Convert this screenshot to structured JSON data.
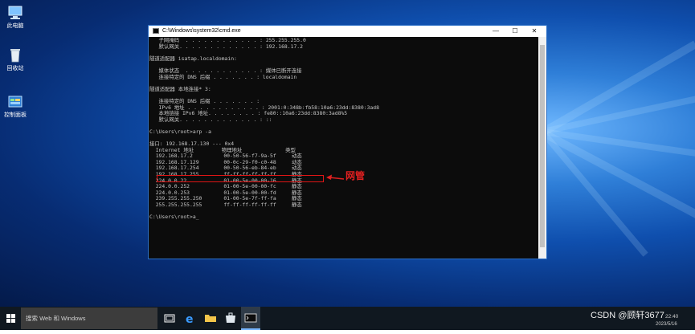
{
  "desktop": {
    "icons": [
      {
        "name": "此电脑"
      },
      {
        "name": "回收站"
      },
      {
        "name": "控制面板"
      }
    ]
  },
  "window": {
    "title": "C:\\Windows\\system32\\cmd.exe",
    "buttons": {
      "minimize": "—",
      "maximize": "☐",
      "close": "✕"
    }
  },
  "console": {
    "lines": [
      "   子网掩码  . . . . . . . . . . . . : 255.255.255.0",
      "   默认网关. . . . . . . . . . . . . : 192.168.17.2",
      "",
      "隧道适配器 isatap.localdomain:",
      "",
      "   媒体状态  . . . . . . . . . . . . : 媒体已断开连接",
      "   连接特定的 DNS 后缀 . . . . . . . : localdomain",
      "",
      "隧道适配器 本地连接* 3:",
      "",
      "   连接特定的 DNS 后缀 . . . . . . . :",
      "   IPv6 地址 . . . . . . . . . . . . : 2001:0:348b:fb58:10a6:23dd:8380:3ad8",
      "   本地链接 IPv6 地址. . . . . . . . : fe80::10a6:23dd:8380:3ad8%5",
      "   默认网关. . . . . . . . . . . . . : ::",
      "",
      "C:\\Users\\root>arp -a",
      "",
      "接口: 192.168.17.130 --- 0x4",
      "  Internet 地址         物理地址              类型",
      "  192.168.17.2          00-50-56-f7-9a-5f     动态",
      "  192.168.17.129        00-0c-29-f0-c0-48     动态",
      "  192.168.17.254        00-50-56-eb-84-eb     动态",
      "  192.168.17.255        ff-ff-ff-ff-ff-ff     静态",
      "  224.0.0.22            01-00-5e-00-00-16     静态",
      "  224.0.0.252           01-00-5e-00-00-fc     静态",
      "  224.0.0.253           01-00-5e-00-00-fd     静态",
      "  239.255.255.250       01-00-5e-7f-ff-fa     静态",
      "  255.255.255.255       ff-ff-ff-ff-ff-ff     静态",
      "",
      "C:\\Users\\root>a_"
    ]
  },
  "annotation": {
    "label": "网管"
  },
  "taskbar": {
    "search_placeholder": "搜索 Web 和 Windows",
    "apps": [
      "task-view",
      "edge",
      "file-explorer",
      "store",
      "cmd"
    ],
    "tray": {
      "time": "22:40",
      "date": "2023/5/16"
    }
  },
  "watermark": "CSDN @顾轩3677",
  "colors": {
    "console_bg": "#0c0c0c",
    "console_text": "#c8c8c8",
    "annotation": "#e02020",
    "taskbar": "#101820"
  }
}
